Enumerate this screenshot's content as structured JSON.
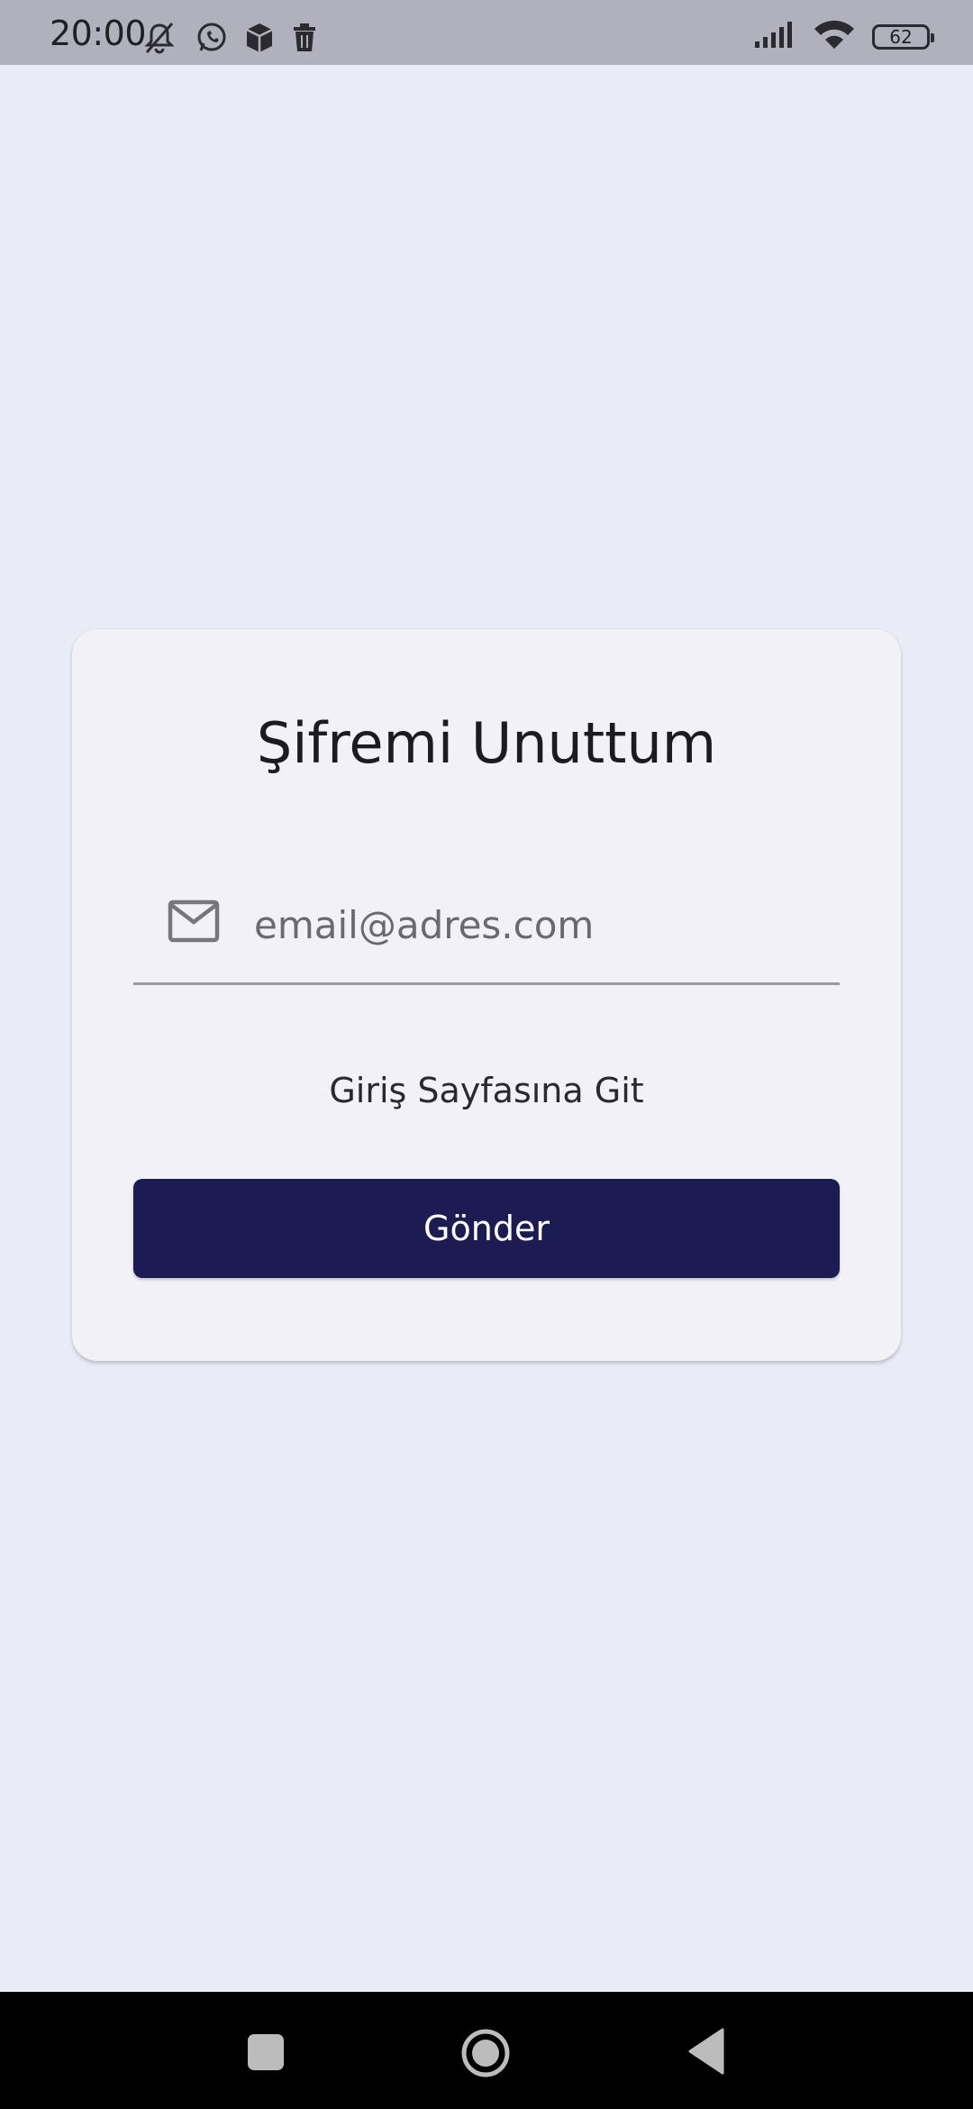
{
  "status_bar": {
    "time": "20:00",
    "left_icons": [
      "notifications-muted-icon",
      "whatsapp-icon",
      "package-icon",
      "trash-icon"
    ],
    "right_icons": [
      "signal-icon",
      "wifi-icon",
      "battery-icon"
    ],
    "battery_level": "62"
  },
  "forgot_password": {
    "title": "Şifremi Unuttum",
    "email_placeholder": "email@adres.com",
    "email_value": "",
    "login_link_label": "Giriş Sayfasına Git",
    "submit_label": "Gönder"
  },
  "nav_bar": {
    "buttons": [
      "recents-icon",
      "home-icon",
      "back-icon"
    ]
  },
  "colors": {
    "background": "#e9ebf7",
    "card": "#f2f1f5",
    "primary_button": "#1c1c52",
    "status_bar": "#b0b1bd"
  }
}
